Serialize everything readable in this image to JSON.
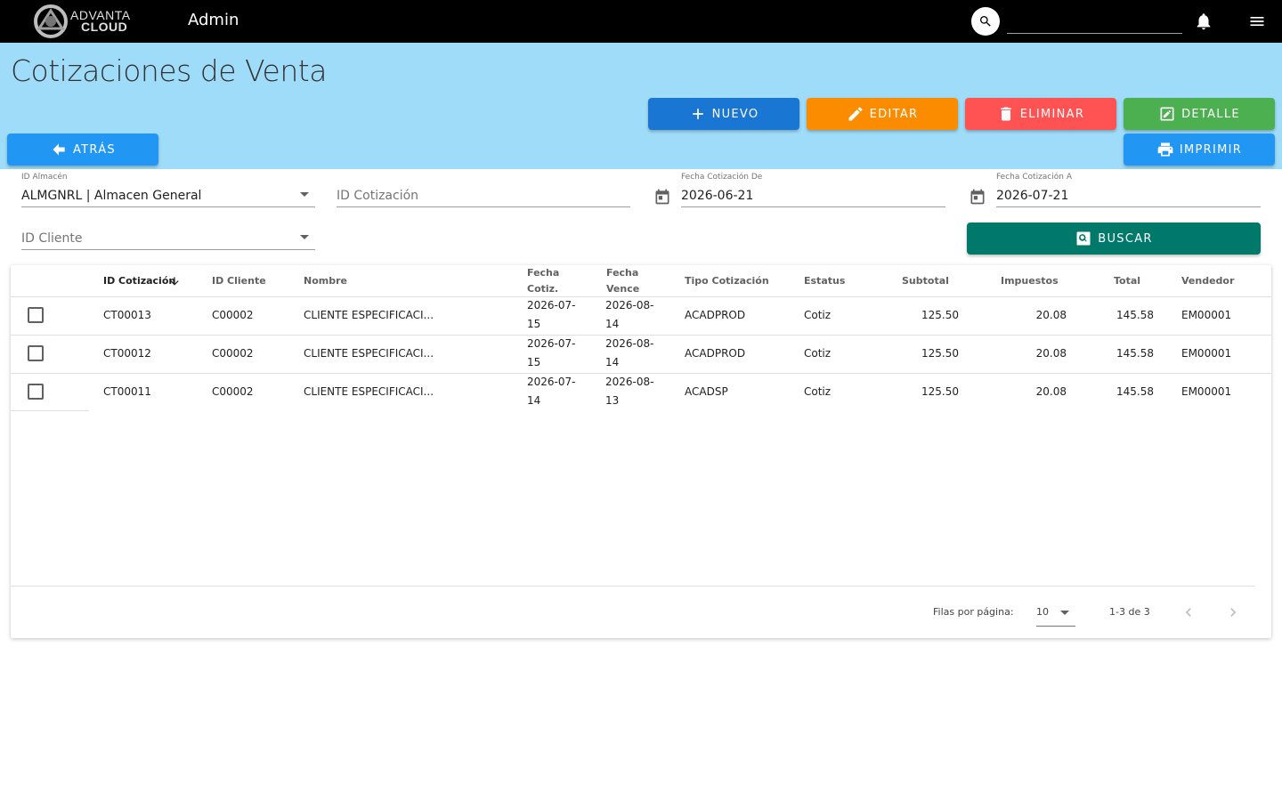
{
  "topbar": {
    "logo_line1": "ADVANTA",
    "logo_line2": "CLOUD",
    "title": "Admin",
    "search_placeholder": ""
  },
  "page": {
    "title": "Cotizaciones de Venta"
  },
  "actions": {
    "nuevo": "NUEVO",
    "editar": "EDITAR",
    "eliminar": "ELIMINAR",
    "detalle": "DETALLE",
    "atras": "ATRÁS",
    "imprimir": "IMPRIMIR",
    "buscar": "BUSCAR"
  },
  "filters": {
    "almacen_label": "ID Almacén",
    "almacen_value": "ALMGNRL | Almacen General",
    "cotizacion_placeholder": "ID Cotización",
    "fecha_de_label": "Fecha Cotización De",
    "fecha_de_value": "2026-06-21",
    "fecha_a_label": "Fecha Cotización A",
    "fecha_a_value": "2026-07-21",
    "cliente_placeholder": "ID Cliente"
  },
  "table": {
    "headers": {
      "id_cotizacion": "ID Cotización",
      "id_cliente": "ID Cliente",
      "nombre": "Nombre",
      "fecha_cotiz_1": "Fecha",
      "fecha_cotiz_2": "Cotiz.",
      "fecha_vence_1": "Fecha",
      "fecha_vence_2": "Vence",
      "tipo": "Tipo Cotización",
      "estatus": "Estatus",
      "subtotal": "Subtotal",
      "impuestos": "Impuestos",
      "total": "Total",
      "vendedor": "Vendedor"
    },
    "rows": [
      {
        "id": "CT00013",
        "cliente": "C00002",
        "nombre": "CLIENTE ESPECIFICACI...",
        "fc1": "2026-07-",
        "fc2": "15",
        "fv1": "2026-08-",
        "fv2": "14",
        "tipo": "ACADPROD",
        "estatus": "Cotiz",
        "subtotal": "125.50",
        "impuestos": "20.08",
        "total": "145.58",
        "vendedor": "EM00001"
      },
      {
        "id": "CT00012",
        "cliente": "C00002",
        "nombre": "CLIENTE ESPECIFICACI...",
        "fc1": "2026-07-",
        "fc2": "15",
        "fv1": "2026-08-",
        "fv2": "14",
        "tipo": "ACADPROD",
        "estatus": "Cotiz",
        "subtotal": "125.50",
        "impuestos": "20.08",
        "total": "145.58",
        "vendedor": "EM00001"
      },
      {
        "id": "CT00011",
        "cliente": "C00002",
        "nombre": "CLIENTE ESPECIFICACI...",
        "fc1": "2026-07-",
        "fc2": "14",
        "fv1": "2026-08-",
        "fv2": "13",
        "tipo": "ACADSP",
        "estatus": "Cotiz",
        "subtotal": "125.50",
        "impuestos": "20.08",
        "total": "145.58",
        "vendedor": "EM00001"
      }
    ],
    "footer": {
      "rows_per_page_label": "Filas por página:",
      "rows_per_page_value": "10",
      "range": "1-3 de 3"
    }
  },
  "colors": {
    "topbar": "#000000",
    "header_band": "#9fdcf9",
    "nuevo": "#1976d2",
    "editar": "#fb8c00",
    "eliminar": "#ff5252",
    "detalle": "#4caf50",
    "atras": "#2196f3",
    "buscar": "#00796b"
  }
}
